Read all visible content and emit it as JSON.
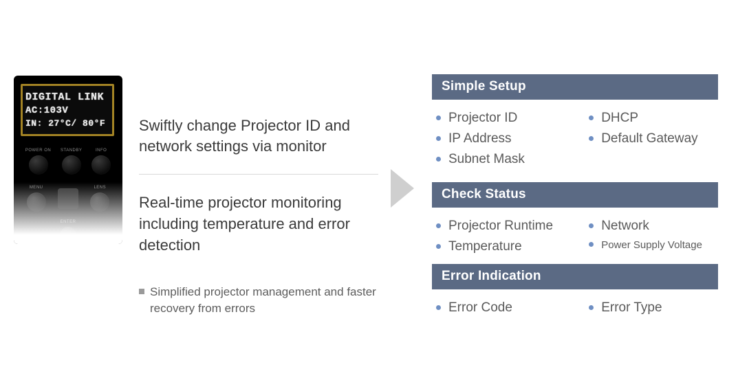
{
  "remote": {
    "display": {
      "line1": "DIGITAL LINK",
      "line2": "AC:103V",
      "line3": "IN: 27°C/ 80°F"
    },
    "row1": {
      "b1": "POWER ON",
      "b2": "STANDBY",
      "b3": "INFO"
    },
    "row2": {
      "b1": "MENU",
      "b2": "",
      "b3": "LENS"
    },
    "enter": "ENTER"
  },
  "mid": {
    "heading1": "Swiftly change Projector ID and network settings via monitor",
    "heading2": "Real-time projector monitoring including temperature and error detection",
    "note": "Simplified projector management and faster recovery from errors"
  },
  "sections": {
    "simple_setup": {
      "title": "Simple Setup",
      "colA": [
        "Projector ID",
        "IP Address",
        "Subnet Mask"
      ],
      "colB": [
        "DHCP",
        "Default Gateway"
      ]
    },
    "check_status": {
      "title": "Check Status",
      "colA": [
        "Projector Runtime",
        "Temperature"
      ],
      "colB": [
        "Network",
        "Power Supply Voltage"
      ]
    },
    "error_indication": {
      "title": "Error Indication",
      "colA": [
        "Error Code"
      ],
      "colB": [
        "Error Type"
      ]
    }
  }
}
